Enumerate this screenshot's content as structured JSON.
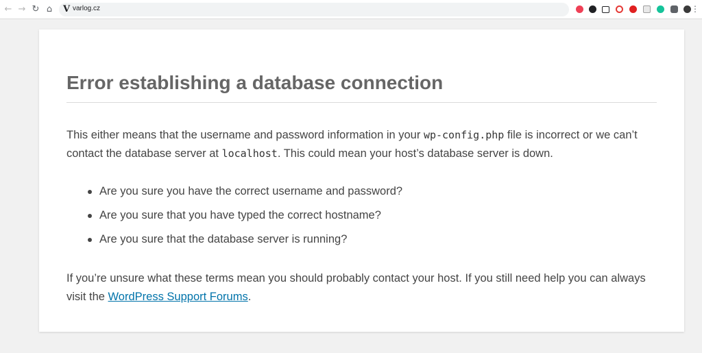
{
  "browser": {
    "back_icon": "arrow-left-icon",
    "forward_icon": "arrow-right-icon",
    "reload_icon": "reload-icon",
    "home_icon": "home-icon",
    "site_glyph": "V",
    "url": "varlog.cz",
    "extensions": [
      {
        "name": "pocket-icon",
        "color": "#ef4056"
      },
      {
        "name": "shield-icon",
        "color": "#202124"
      },
      {
        "name": "picture-in-picture-icon",
        "color": "#202124"
      },
      {
        "name": "link-icon",
        "color": "#e53935"
      },
      {
        "name": "block-icon",
        "color": "#e02020"
      },
      {
        "name": "page-icon",
        "color": "#9e9e9e"
      },
      {
        "name": "grammarly-icon",
        "color": "#15c39a"
      },
      {
        "name": "puzzle-icon",
        "color": "#5f6368"
      },
      {
        "name": "profile-icon",
        "color": "#3a3a3a"
      }
    ]
  },
  "error": {
    "title": "Error establishing a database connection",
    "p1_part1": "This either means that the username and password information in your ",
    "p1_code1": "wp-config.php",
    "p1_part2": " file is incorrect or we can’t contact the database server at ",
    "p1_code2": "localhost",
    "p1_part3": ". This could mean your host’s database server is down.",
    "checklist": [
      "Are you sure you have the correct username and password?",
      "Are you sure that you have typed the correct hostname?",
      "Are you sure that the database server is running?"
    ],
    "p2_part1": "If you’re unsure what these terms mean you should probably contact your host. If you still need help you can always visit the ",
    "p2_link": "WordPress Support Forums",
    "p2_part2": "."
  }
}
